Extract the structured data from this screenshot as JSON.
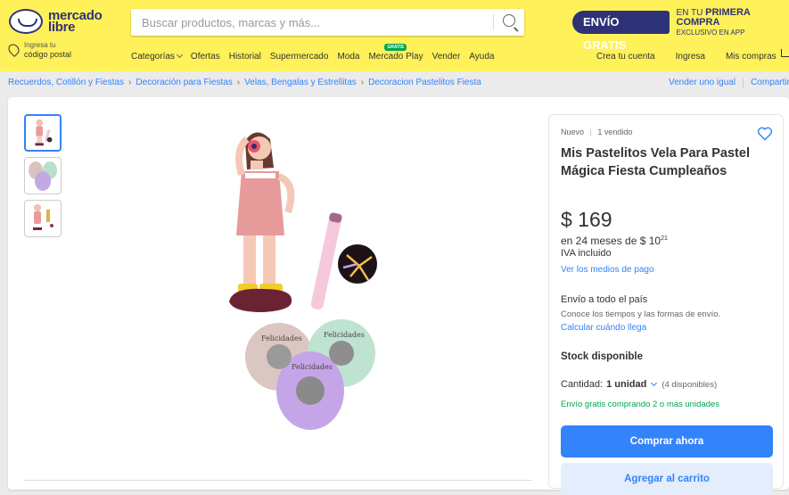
{
  "header": {
    "logo_line1": "mercado",
    "logo_line2": "libre",
    "search_placeholder": "Buscar productos, marcas y más...",
    "promo_badge": "ENVÍO GRATIS",
    "promo_line1_pre": "EN TU ",
    "promo_line1_bold": "PRIMERA COMPRA",
    "promo_line2": "EXCLUSIVO EN APP",
    "location_line1": "Ingresa tu",
    "location_line2": "código postal",
    "nav": [
      {
        "label": "Categorías"
      },
      {
        "label": "Ofertas"
      },
      {
        "label": "Historial"
      },
      {
        "label": "Supermercado"
      },
      {
        "label": "Moda"
      },
      {
        "label": "Mercado Play",
        "badge": "GRATIS"
      },
      {
        "label": "Vender"
      },
      {
        "label": "Ayuda"
      }
    ],
    "account": {
      "create": "Crea tu cuenta",
      "login": "Ingresa",
      "purchases": "Mis compras"
    }
  },
  "breadcrumb": {
    "items": [
      "Recuerdos, Cotillón y Fiestas",
      "Decoración para Fiestas",
      "Velas, Bengalas y Estrellitas",
      "Decoracion Pastelitos Fiesta"
    ],
    "sell_similar": "Vender uno igual",
    "share": "Compartir"
  },
  "product": {
    "condition": "Nuevo",
    "sold": "1 vendido",
    "title": "Mis Pastelitos Vela Para Pastel Mágica Fiesta Cumpleaños",
    "price": "$ 169",
    "installments_text": "en 24 meses de $ 10",
    "installments_cents": "21",
    "iva": "IVA incluido",
    "payment_link": "Ver los medios de pago",
    "shipping_title": "Envío a todo el país",
    "shipping_desc": "Conoce los tiempos y las formas de envío.",
    "shipping_link": "Calcular cuándo llega",
    "stock": "Stock disponible",
    "quantity_label": "Cantidad:",
    "quantity_value": "1 unidad",
    "quantity_available": "(4 disponibles)",
    "free_shipping": "Envío gratis comprando 2 o más unidades",
    "buy_now": "Comprar ahora",
    "add_cart": "Agregar al carrito"
  },
  "balloon_text": "Felicidades",
  "colors": {
    "header_yellow": "#fff159",
    "brand_navy": "#2d3277",
    "link_blue": "#3483fa",
    "success_green": "#00a650"
  }
}
